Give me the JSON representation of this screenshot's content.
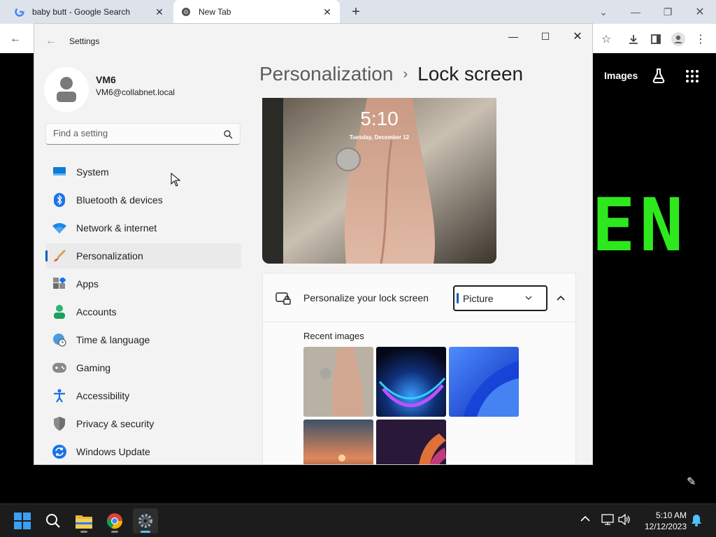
{
  "browser": {
    "tabs": [
      {
        "title": "baby butt - Google Search",
        "favicon": "google-g-icon"
      },
      {
        "title": "New Tab",
        "favicon": "chrome-icon"
      }
    ],
    "new_tab": "+",
    "page": {
      "images_link": "Images",
      "lab_icon": "flask-icon",
      "apps_icon": "apps-grid-icon",
      "doodle_text": "EN",
      "doodle_color": "#2ee81e"
    }
  },
  "settings": {
    "app_title": "Settings",
    "user": {
      "name": "VM6",
      "email": "VM6@collabnet.local"
    },
    "search": {
      "placeholder": "Find a setting"
    },
    "nav": [
      {
        "label": "System",
        "icon": "monitor-icon"
      },
      {
        "label": "Bluetooth & devices",
        "icon": "bluetooth-icon"
      },
      {
        "label": "Network & internet",
        "icon": "wifi-icon"
      },
      {
        "label": "Personalization",
        "icon": "brush-icon",
        "active": true
      },
      {
        "label": "Apps",
        "icon": "apps-icon"
      },
      {
        "label": "Accounts",
        "icon": "person-icon"
      },
      {
        "label": "Time & language",
        "icon": "globe-clock-icon"
      },
      {
        "label": "Gaming",
        "icon": "gamepad-icon"
      },
      {
        "label": "Accessibility",
        "icon": "accessibility-icon"
      },
      {
        "label": "Privacy & security",
        "icon": "shield-icon"
      },
      {
        "label": "Windows Update",
        "icon": "update-icon"
      }
    ],
    "breadcrumb": {
      "parent": "Personalization",
      "separator": "›",
      "current": "Lock screen"
    },
    "preview": {
      "time": "5:10",
      "date": "Tuesday, December 12"
    },
    "personalize": {
      "label": "Personalize your lock screen",
      "dropdown_value": "Picture",
      "recent_label": "Recent images"
    },
    "accent_color": "#005fb8"
  },
  "taskbar": {
    "apps": [
      "start-icon",
      "search-icon",
      "file-explorer-icon",
      "chrome-icon",
      "settings-icon"
    ],
    "clock": {
      "time": "5:10 AM",
      "date": "12/12/2023"
    }
  }
}
